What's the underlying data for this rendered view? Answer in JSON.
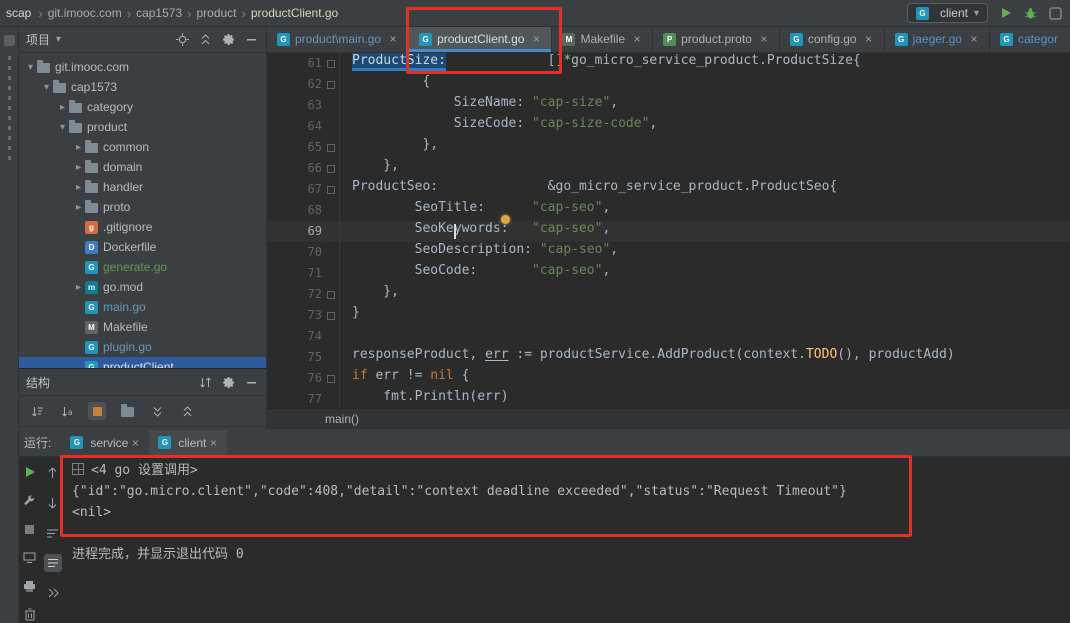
{
  "palette": {
    "panel_bg": "#3c3f41",
    "editor_bg": "#2b2b2b",
    "tab_underline_blue": "#4a88c7",
    "selection_blue": "#2d5b9e",
    "string_green": "#6a8759",
    "keyword_orange": "#cc7832",
    "function_yellow": "#ffc66b",
    "annotation_red": "#e33025",
    "run_green": "#5caf53"
  },
  "glyphs": {
    "separator": "›",
    "close": "×",
    "expanded": "▾",
    "collapsed": "▸"
  },
  "top_bar": {
    "window_title": "scap",
    "breadcrumbs": [
      "git.imooc.com",
      "cap1573",
      "product",
      "productClient.go"
    ],
    "run_config": "client"
  },
  "project_panel": {
    "title": "项目",
    "tree": [
      {
        "label": "git.imooc.com",
        "level": 0,
        "arrow": "down",
        "icon": "folder"
      },
      {
        "label": "cap1573",
        "level": 1,
        "arrow": "down",
        "icon": "folder"
      },
      {
        "label": "category",
        "level": 2,
        "arrow": "right",
        "icon": "folder"
      },
      {
        "label": "product",
        "level": 2,
        "arrow": "down",
        "icon": "folder"
      },
      {
        "label": "common",
        "level": 3,
        "arrow": "right",
        "icon": "folder"
      },
      {
        "label": "domain",
        "level": 3,
        "arrow": "right",
        "icon": "folder"
      },
      {
        "label": "handler",
        "level": 3,
        "arrow": "right",
        "icon": "folder"
      },
      {
        "label": "proto",
        "level": 3,
        "arrow": "right",
        "icon": "folder"
      },
      {
        "label": ".gitignore",
        "level": 3,
        "icon": "git"
      },
      {
        "label": "Dockerfile",
        "level": 3,
        "icon": "docker"
      },
      {
        "label": "generate.go",
        "level": 3,
        "icon": "go",
        "color": "#629755"
      },
      {
        "label": "go.mod",
        "level": 3,
        "arrow": "right",
        "icon": "gomod"
      },
      {
        "label": "main.go",
        "level": 3,
        "icon": "go",
        "color": "#6897bb"
      },
      {
        "label": "Makefile",
        "level": 3,
        "icon": "mk"
      },
      {
        "label": "plugin.go",
        "level": 3,
        "icon": "go",
        "color": "#6897bb"
      },
      {
        "label": "productClient",
        "level": 3,
        "icon": "go",
        "selected": true,
        "color": "#dde2e6"
      }
    ]
  },
  "structure_panel": {
    "title": "结构"
  },
  "editor": {
    "tabs": [
      {
        "label": "product\\main.go",
        "icon": "go",
        "color": "#6897bb",
        "close": true
      },
      {
        "label": "productClient.go",
        "icon": "go",
        "color": "#d8dee3",
        "close": true,
        "selected": true
      },
      {
        "label": "Makefile",
        "icon": "mk",
        "color": "#afb1b3",
        "close": true
      },
      {
        "label": "product.proto",
        "icon": "proto",
        "color": "#afb1b3",
        "close": true
      },
      {
        "label": "config.go",
        "icon": "go",
        "color": "#afb1b3",
        "close": true
      },
      {
        "label": "jaeger.go",
        "icon": "go",
        "color": "#5394ce",
        "close": true
      },
      {
        "label": "categor",
        "icon": "go",
        "color": "#5394ce",
        "close": false
      }
    ],
    "breadcrumb": "main()",
    "code": {
      "lines": [
        {
          "num": 61,
          "fold": true,
          "tokens": [
            {
              "c": "sel",
              "t": "ProductSize:"
            },
            {
              "c": "p",
              "t": "             []*go_micro_service_product.ProductSize{"
            }
          ]
        },
        {
          "num": 62,
          "fold": true,
          "tokens": [
            {
              "c": "p",
              "t": "         {"
            }
          ]
        },
        {
          "num": 63,
          "tokens": [
            {
              "c": "p",
              "t": "             SizeName: "
            },
            {
              "c": "s",
              "t": "\"cap-size\""
            },
            {
              "c": "p",
              "t": ","
            }
          ]
        },
        {
          "num": 64,
          "tokens": [
            {
              "c": "p",
              "t": "             SizeCode: "
            },
            {
              "c": "s",
              "t": "\"cap-size-code\""
            },
            {
              "c": "p",
              "t": ","
            }
          ]
        },
        {
          "num": 65,
          "fold": true,
          "tokens": [
            {
              "c": "p",
              "t": "         },"
            }
          ]
        },
        {
          "num": 66,
          "fold": true,
          "tokens": [
            {
              "c": "p",
              "t": "    },"
            }
          ]
        },
        {
          "num": 67,
          "fold": true,
          "tokens": [
            {
              "c": "p",
              "t": "ProductSeo:              &go_micro_service_product.ProductSeo{"
            }
          ]
        },
        {
          "num": 68,
          "tokens": [
            {
              "c": "p",
              "t": "        SeoTitle:      "
            },
            {
              "c": "s",
              "t": "\"cap-seo\""
            },
            {
              "c": "p",
              "t": ","
            }
          ]
        },
        {
          "num": 69,
          "active": true,
          "tokens": [
            {
              "c": "p",
              "t": "        SeoKeywords:   "
            },
            {
              "c": "s",
              "t": "\"cap-seo\""
            },
            {
              "c": "p",
              "t": ","
            }
          ]
        },
        {
          "num": 70,
          "tokens": [
            {
              "c": "p",
              "t": "        SeoDescription: "
            },
            {
              "c": "s",
              "t": "\"cap-seo\""
            },
            {
              "c": "p",
              "t": ","
            }
          ]
        },
        {
          "num": 71,
          "tokens": [
            {
              "c": "p",
              "t": "        SeoCode:       "
            },
            {
              "c": "s",
              "t": "\"cap-seo\""
            },
            {
              "c": "p",
              "t": ","
            }
          ]
        },
        {
          "num": 72,
          "fold": true,
          "tokens": [
            {
              "c": "p",
              "t": "    },"
            }
          ]
        },
        {
          "num": 73,
          "fold": true,
          "tokens": [
            {
              "c": "p",
              "t": "}"
            }
          ]
        },
        {
          "num": 74,
          "tokens": []
        },
        {
          "num": 75,
          "tokens": [
            {
              "c": "p",
              "t": "responseProduct, "
            },
            {
              "c": "u",
              "t": "err"
            },
            {
              "c": "p",
              "t": " := productService.AddProduct(context."
            },
            {
              "c": "f",
              "t": "TODO"
            },
            {
              "c": "p",
              "t": "(), productAdd)"
            }
          ]
        },
        {
          "num": 76,
          "fold": true,
          "tokens": [
            {
              "c": "k",
              "t": "if"
            },
            {
              "c": "p",
              "t": " err != "
            },
            {
              "c": "k",
              "t": "nil"
            },
            {
              "c": "p",
              "t": " {"
            }
          ]
        },
        {
          "num": 77,
          "tokens": [
            {
              "c": "p",
              "t": "    fmt.Println(err)"
            }
          ]
        }
      ]
    }
  },
  "run_panel": {
    "label": "运行:",
    "tabs": [
      {
        "label": "service",
        "icon": "go"
      },
      {
        "label": "client",
        "icon": "go",
        "selected": true
      }
    ],
    "console": {
      "fold_line": "<4 go 设置调用>",
      "lines": [
        "{\"id\":\"go.micro.client\",\"code\":408,\"detail\":\"context deadline exceeded\",\"status\":\"Request Timeout\"}",
        "<nil>"
      ],
      "exit_line": "进程完成，并显示退出代码 0"
    }
  }
}
